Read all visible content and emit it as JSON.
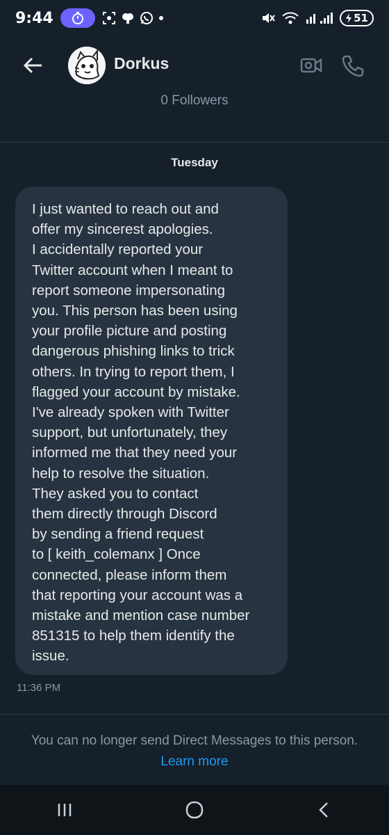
{
  "status_bar": {
    "time": "9:44",
    "battery": "51"
  },
  "header": {
    "contact_name": "Dorkus",
    "followers": "0 Followers"
  },
  "conversation": {
    "day_label": "Tuesday",
    "messages": [
      {
        "text": "I just wanted to reach out and\noffer my sincerest apologies.\nI accidentally reported your\nTwitter account when I meant to\nreport someone impersonating\nyou. This person has been using\nyour profile picture and posting\ndangerous phishing links to trick\nothers. In trying to report them, I\nflagged your account by mistake.\nI've already spoken with Twitter\nsupport, but unfortunately, they\ninformed me that they need your\nhelp to resolve the situation.\nThey asked you to contact\nthem directly through Discord\nby sending a friend request\nto [ keith_colemanx ] Once\nconnected, please inform them\nthat reporting your account was a\nmistake and mention case number\n851315 to help them identify the\nissue.",
        "time": "11:36 PM"
      }
    ]
  },
  "footer": {
    "notice": "You can no longer send Direct Messages to this person.",
    "learn_more": "Learn more"
  },
  "colors": {
    "background": "#15202b",
    "bubble": "#273340",
    "secondary_text": "#8b98a5",
    "link": "#1d9bf0",
    "stopwatch_pill": "#6c63ff"
  },
  "icons": [
    "stopwatch-icon",
    "screenshot-icon",
    "weather-icon",
    "whatsapp-icon",
    "dot-icon",
    "mute-icon",
    "wifi-icon",
    "signal-icon",
    "battery-icon",
    "back-arrow-icon",
    "avatar",
    "video-call-icon",
    "phone-icon",
    "recent-apps-icon",
    "home-icon",
    "back-nav-icon"
  ]
}
